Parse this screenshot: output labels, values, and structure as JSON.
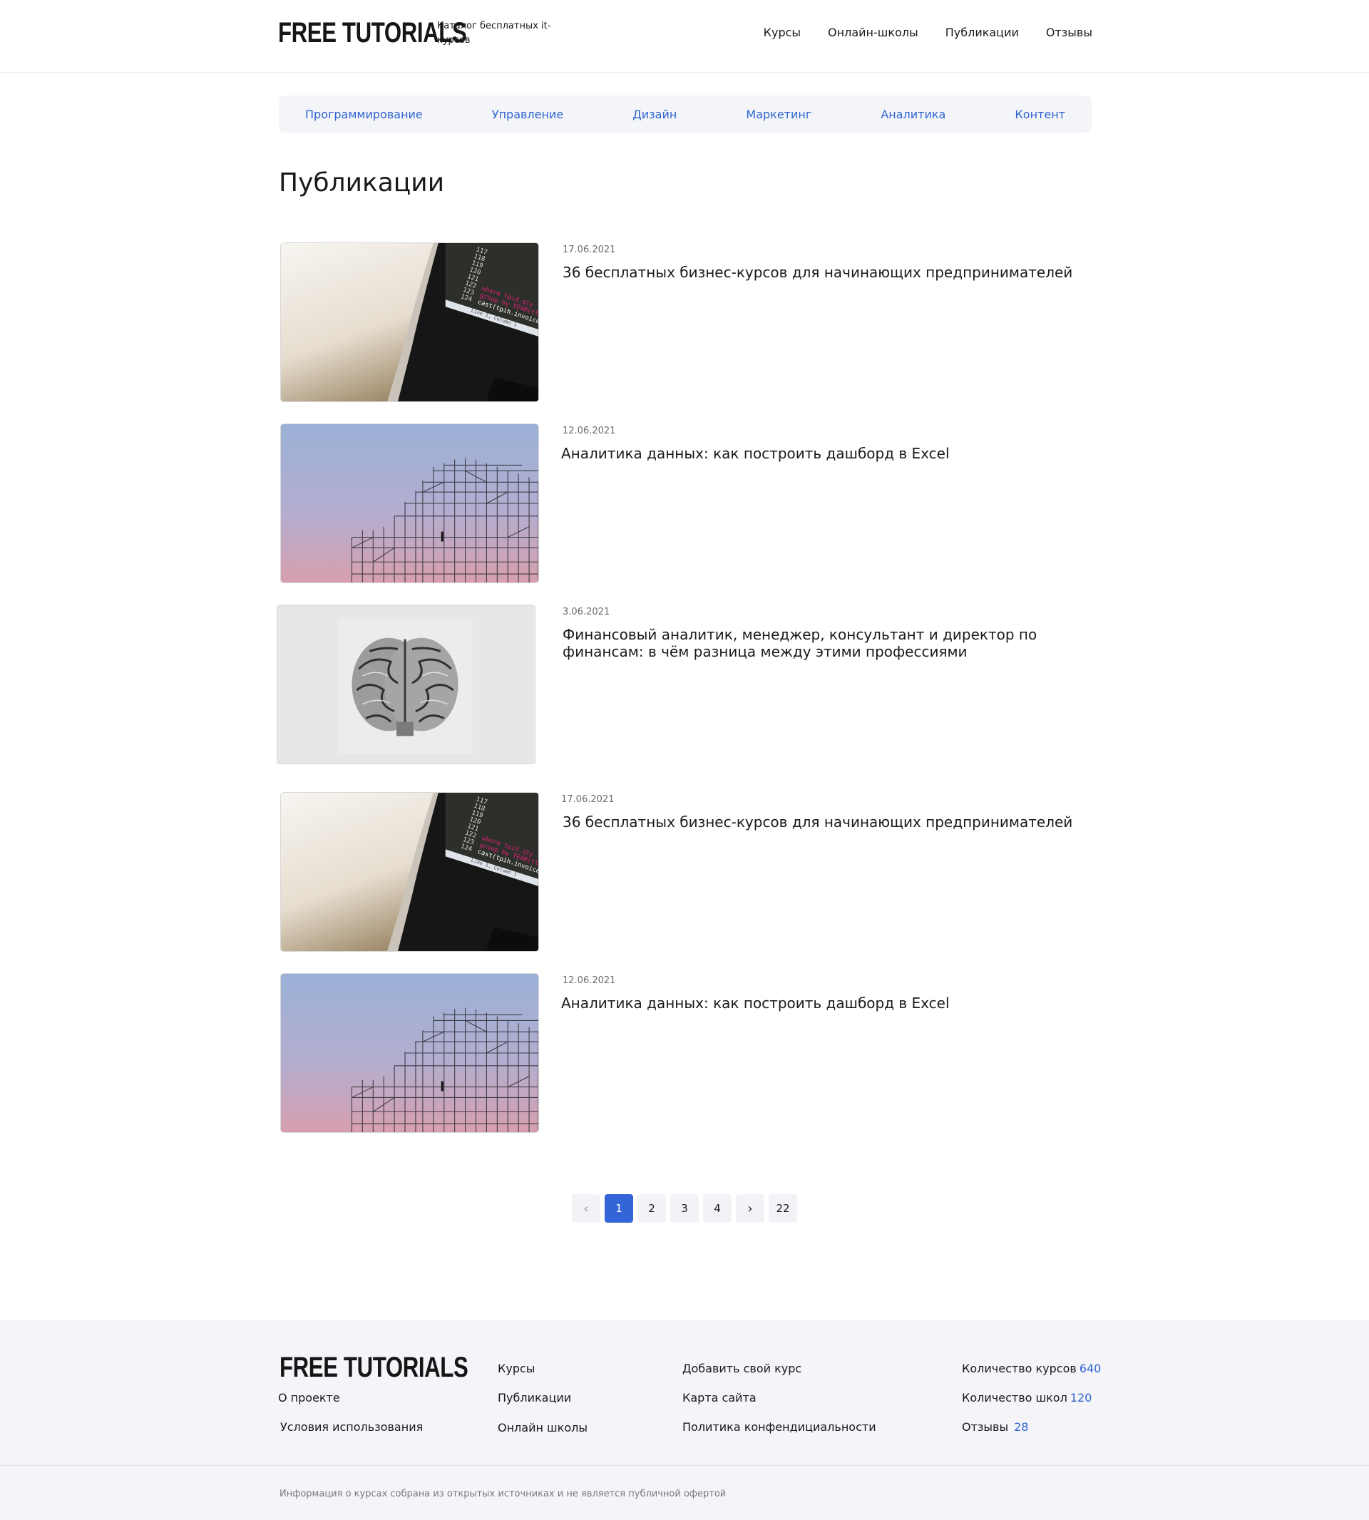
{
  "header": {
    "logo": "FREE TUTORIALS",
    "tagline": "Каталог бесплатных it-курсов",
    "nav": [
      "Курсы",
      "Онлайн-школы",
      "Публикации",
      "Отзывы"
    ]
  },
  "categories": [
    "Программирование",
    "Управление",
    "Дизайн",
    "Маркетинг",
    "Аналитика",
    "Контент"
  ],
  "page_title": "Публикации",
  "articles": [
    {
      "date": "17.06.2021",
      "title": "36 бесплатных бизнес-курсов для начинающих предпринимателей",
      "image": "laptop-code"
    },
    {
      "date": "12.06.2021",
      "title": "Аналитика данных: как построить дашборд в Excel",
      "image": "scaffolding-sky"
    },
    {
      "date": "3.06.2021",
      "title": "Финансовый аналитик, менеджер, консультант и директор по финансам: в чём разница между этими профессиями",
      "image": "brain-sculpture"
    },
    {
      "date": "17.06.2021",
      "title": "36 бесплатных бизнес-курсов для начинающих предпринимателей",
      "image": "laptop-code"
    },
    {
      "date": "12.06.2021",
      "title": "Аналитика данных: как построить дашборд в Excel",
      "image": "scaffolding-sky"
    }
  ],
  "thumb_code": {
    "line_numbers": [
      "117",
      "118",
      "119",
      "120",
      "121",
      "122",
      "123",
      "124"
    ],
    "code_lines": [
      "where tpid.qty",
      "group by YEAR(tl",
      "cast(tpih.invoice",
      "Line 1, Column 1"
    ]
  },
  "pagination": {
    "prev_icon": "chevron-left-icon",
    "next_icon": "chevron-right-icon",
    "pages": [
      "1",
      "2",
      "3",
      "4"
    ],
    "current": "1",
    "last": "22"
  },
  "footer": {
    "logo": "FREE TUTORIALS",
    "col1": [
      "О проекте",
      "Условия использования"
    ],
    "col2": [
      "Курсы",
      "Публикации",
      "Онлайн школы"
    ],
    "col3": [
      "Добавить свой курс",
      "Карта сайта",
      "Политика конфендициальности"
    ],
    "stats": [
      {
        "label": "Количество курсов",
        "value": "640"
      },
      {
        "label": "Количество школ",
        "value": "120"
      },
      {
        "label": "Отзывы",
        "value": "28"
      }
    ],
    "disclaimer": "Информация о курсах собрана из открытых источниках и не является публичной офертой"
  },
  "colors": {
    "accent": "#2f64d1",
    "active_page": "#3465d8",
    "category_bar_bg": "#f4f5f9",
    "footer_bg": "#f4f4f9"
  }
}
